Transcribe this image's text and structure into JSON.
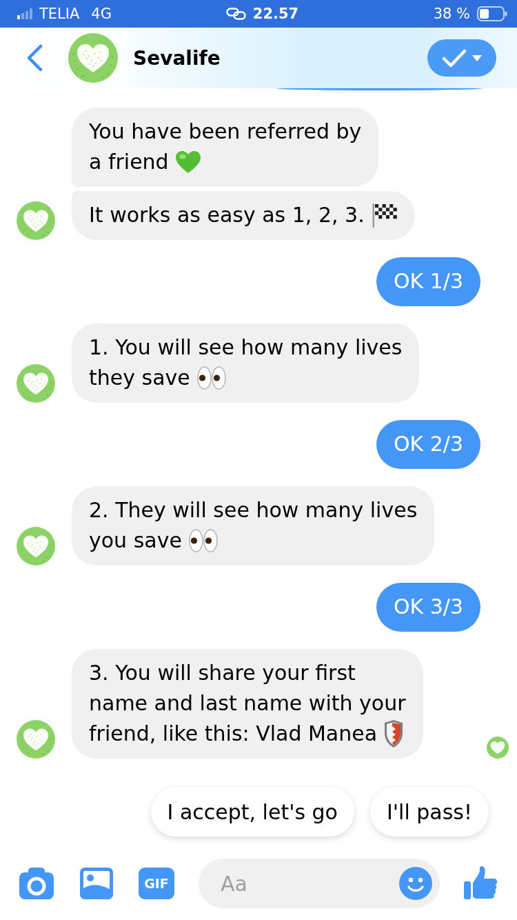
{
  "status_bar": {
    "carrier": "TELIA",
    "network": "4G",
    "time": "22.57",
    "battery": "38 %"
  },
  "header": {
    "title": "Sevalife"
  },
  "messages": [
    {
      "kind": "received",
      "seen": false,
      "bubbles": [
        {
          "lines": [
            "You have been referred by",
            "a friend"
          ]
        },
        {
          "lines": [
            "It works as easy as 1, 2, 3."
          ]
        }
      ]
    },
    {
      "kind": "sent",
      "seen": false,
      "bubbles": [
        {
          "lines": [
            "OK 1/3"
          ]
        }
      ]
    },
    {
      "kind": "received",
      "seen": false,
      "bubbles": [
        {
          "lines": [
            "1. You will see how many lives",
            "they save"
          ]
        }
      ]
    },
    {
      "kind": "sent",
      "seen": false,
      "bubbles": [
        {
          "lines": [
            "OK 2/3"
          ]
        }
      ]
    },
    {
      "kind": "received",
      "seen": false,
      "bubbles": [
        {
          "lines": [
            "2. They will see how many lives",
            "you save"
          ]
        }
      ]
    },
    {
      "kind": "sent",
      "seen": false,
      "bubbles": [
        {
          "lines": [
            "OK 3/3"
          ]
        }
      ]
    },
    {
      "kind": "received",
      "seen": true,
      "bubbles": [
        {
          "lines": [
            "3. You will share your first",
            "name and last name with your",
            "friend, like this: Vlad Manea"
          ]
        }
      ]
    }
  ],
  "quick_replies": [
    "I accept, let's go",
    "I'll pass!"
  ],
  "composer": {
    "gif_label": "GIF",
    "placeholder": "Aa"
  }
}
